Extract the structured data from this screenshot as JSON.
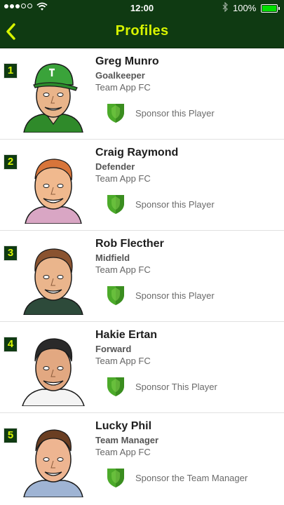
{
  "status": {
    "time": "12:00",
    "battery": "100%"
  },
  "header": {
    "title": "Profiles",
    "back_icon": "chevron-left-icon"
  },
  "colors": {
    "nav_bg": "#0f3a12",
    "title_yellow": "#d7f400",
    "shield_green": "#4caa2a"
  },
  "players": [
    {
      "rank": "1",
      "name": "Greg Munro",
      "position": "Goalkeeper",
      "team": "Team App FC",
      "sponsor": "Sponsor this Player"
    },
    {
      "rank": "2",
      "name": "Craig Raymond",
      "position": "Defender",
      "team": "Team App FC",
      "sponsor": "Sponsor this Player"
    },
    {
      "rank": "3",
      "name": "Rob Flecther",
      "position": "Midfield",
      "team": "Team App FC",
      "sponsor": "Sponsor this Player"
    },
    {
      "rank": "4",
      "name": "Hakie Ertan",
      "position": "Forward",
      "team": "Team App FC",
      "sponsor": "Sponsor This Player"
    },
    {
      "rank": "5",
      "name": "Lucky Phil",
      "position": "Team Manager",
      "team": "Team App FC",
      "sponsor": "Sponsor the Team Manager"
    }
  ]
}
